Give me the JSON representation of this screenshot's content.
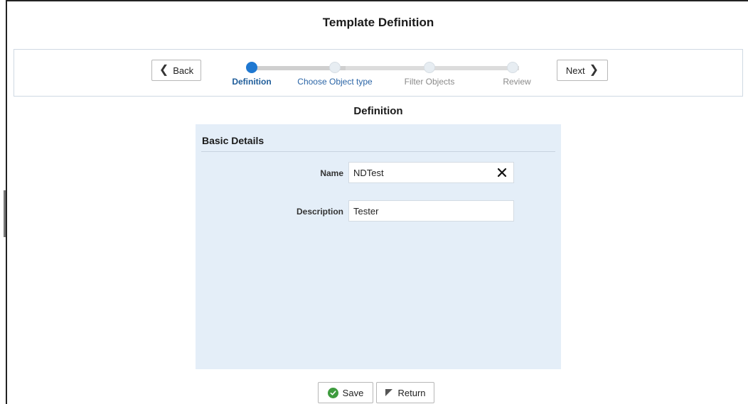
{
  "page": {
    "title": "Template Definition"
  },
  "navigation": {
    "back_label": "Back",
    "next_label": "Next",
    "steps": [
      {
        "label": "Definition",
        "state": "active"
      },
      {
        "label": "Choose Object type",
        "state": "link"
      },
      {
        "label": "Filter Objects",
        "state": "disabled"
      },
      {
        "label": "Review",
        "state": "disabled"
      }
    ]
  },
  "section": {
    "title": "Definition",
    "panel_title": "Basic Details"
  },
  "form": {
    "name_label": "Name",
    "name_value": "NDTest",
    "description_label": "Description",
    "description_value": "Tester"
  },
  "footer": {
    "save_label": "Save",
    "return_label": "Return"
  },
  "colors": {
    "accent": "#1f78d1",
    "panel_bg": "#e4eef8",
    "save_icon": "#3e9b3e"
  },
  "icons": {
    "back": "chevron-left-icon",
    "next": "chevron-right-icon",
    "clear": "close-icon",
    "save": "check-circle-icon",
    "return": "return-arrow-icon"
  }
}
